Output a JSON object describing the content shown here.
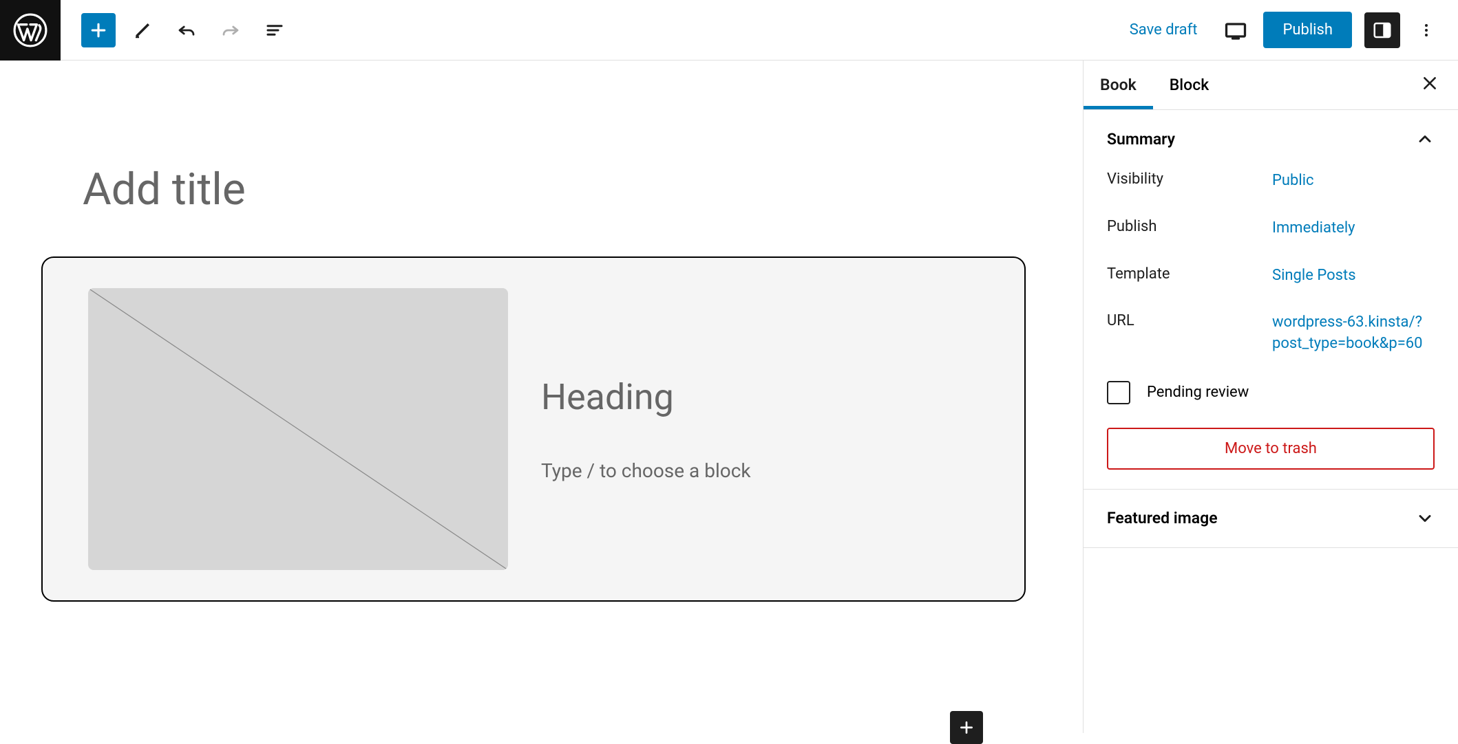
{
  "toolbar": {
    "save_draft": "Save draft",
    "publish": "Publish"
  },
  "editor": {
    "title_placeholder": "Add title",
    "block": {
      "heading_placeholder": "Heading",
      "paragraph_hint": "Type / to choose a block"
    }
  },
  "sidebar": {
    "tabs": {
      "book": "Book",
      "block": "Block"
    },
    "summary": {
      "title": "Summary",
      "visibility_label": "Visibility",
      "visibility_value": "Public",
      "publish_label": "Publish",
      "publish_value": "Immediately",
      "template_label": "Template",
      "template_value": "Single Posts",
      "url_label": "URL",
      "url_value": "wordpress-63.kinsta/?post_type=book&p=60",
      "pending_review": "Pending review",
      "trash": "Move to trash"
    },
    "featured_image": {
      "title": "Featured image"
    }
  }
}
